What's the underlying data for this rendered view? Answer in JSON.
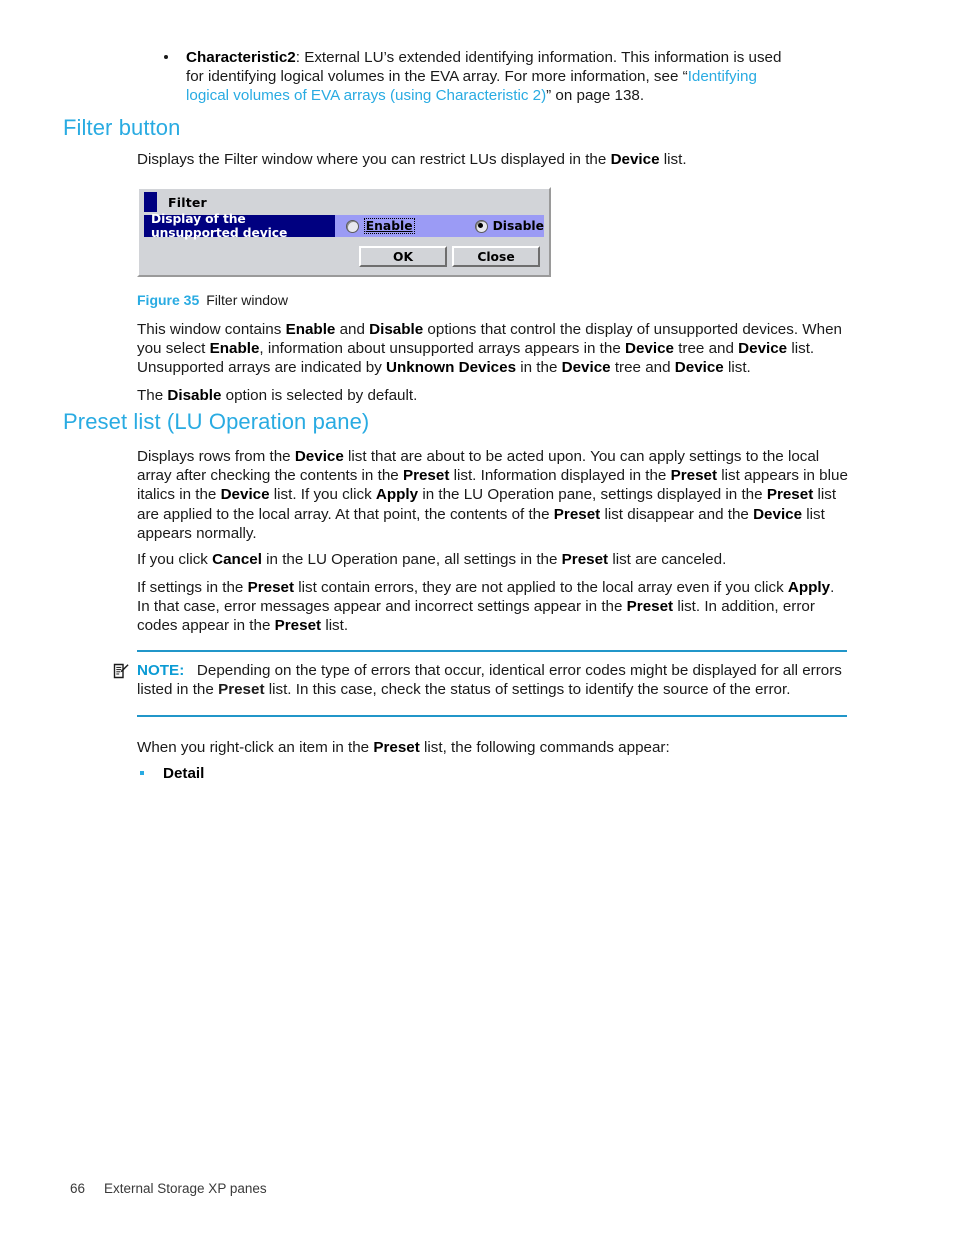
{
  "document": {
    "top_bullet_list": [
      {
        "bullet_type": "round-black",
        "term": "Characteristic2",
        "text_1": ": External LU’s extended identifying information. This information is used for identifying logical volumes in the EVA array. For more information, see “",
        "link_text": "Identifying logical volumes of EVA arrays (using Characteristic 2)",
        "text_2": "” on page 138."
      }
    ],
    "section_filter_button": {
      "heading": "Filter button",
      "intro_1": "Displays the Filter window where you can restrict LUs displayed in the ",
      "intro_bold": "Device",
      "intro_2": " list."
    },
    "filter_dialog": {
      "title": "Filter",
      "option_label": "Display of the unsupported device",
      "radios": [
        {
          "label": "Enable",
          "selected": false,
          "focused": true
        },
        {
          "label": "Disable",
          "selected": true,
          "focused": false
        }
      ],
      "buttons": [
        {
          "label": "OK"
        },
        {
          "label": "Close"
        }
      ]
    },
    "figure_caption": {
      "number": "Figure 35",
      "title": "Filter window"
    },
    "filter_paragraphs": {
      "p1_a": "This window contains ",
      "p1_b1": "Enable",
      "p1_b": " and ",
      "p1_b2": "Disable",
      "p1_c": " options that control the display of unsupported devices. When you select ",
      "p1_b3": "Enable",
      "p1_d": ", information about unsupported arrays appears in the ",
      "p1_b4": "Device",
      "p1_e": " tree and ",
      "p1_b5": "Device",
      "p1_f": " list. Unsupported arrays are indicated by ",
      "p1_b6": "Unknown Devices",
      "p1_g": " in the ",
      "p1_b7": "Device",
      "p1_h": " tree and ",
      "p1_b8": "Device",
      "p1_i": " list.",
      "p2_a": "The ",
      "p2_b": "Disable",
      "p2_c": " option is selected by default."
    },
    "section_preset_list": {
      "heading": "Preset list (LU Operation pane)",
      "p1": {
        "a": "Displays rows from the ",
        "b1": "Device",
        "b": " list that are about to be acted upon. You can apply settings to the local array after checking the contents in the ",
        "b2": "Preset",
        "c": " list. Information displayed in the ",
        "b3": "Preset",
        "d": " list appears in blue italics in the ",
        "b4": "Device",
        "e": " list. If you click ",
        "b5": "Apply",
        "f": " in the LU Operation pane, settings displayed in the ",
        "b6": "Preset",
        "g": " list are applied to the local array. At that point, the contents of the ",
        "b7": "Preset",
        "h": " list disappear and the ",
        "b8": "Device",
        "i": " list appears normally."
      },
      "p2": {
        "a": "If you click ",
        "b1": "Cancel",
        "b": " in the LU Operation pane, all settings in the ",
        "b2": "Preset",
        "c": " list are canceled."
      },
      "p3": {
        "a": "If settings in the ",
        "b1": "Preset",
        "b": " list contain errors, they are not applied to the local array even if you click ",
        "b2": "Apply",
        "c": ". In that case, error messages appear and incorrect settings appear in the ",
        "b3": "Preset",
        "d": " list. In addition, error codes appear in the ",
        "b4": "Preset",
        "e": " list."
      }
    },
    "note": {
      "label": "NOTE:",
      "text_a": "Depending on the type of errors that occur, identical error codes might be displayed for all errors listed in the ",
      "text_b": "Preset",
      "text_c": " list. In this case, check the status of settings to identify the source of the error.",
      "icon": "note-pencil-icon"
    },
    "commands_intro": {
      "a": "When you right-click an item in the ",
      "b": "Preset",
      "c": " list, the following commands appear:"
    },
    "commands_list": [
      {
        "label": "Detail"
      }
    ],
    "footer": {
      "page_number": "66",
      "title": "External Storage XP panes"
    },
    "colors": {
      "accent_heading": "#29abe2",
      "note_rule": "#2196c9",
      "note_label": "#0b9bd4",
      "link": "#29abe2",
      "dialog_navy": "#000080",
      "dialog_lavender": "#9b9bf5",
      "dialog_face": "#d2d4d8"
    }
  }
}
